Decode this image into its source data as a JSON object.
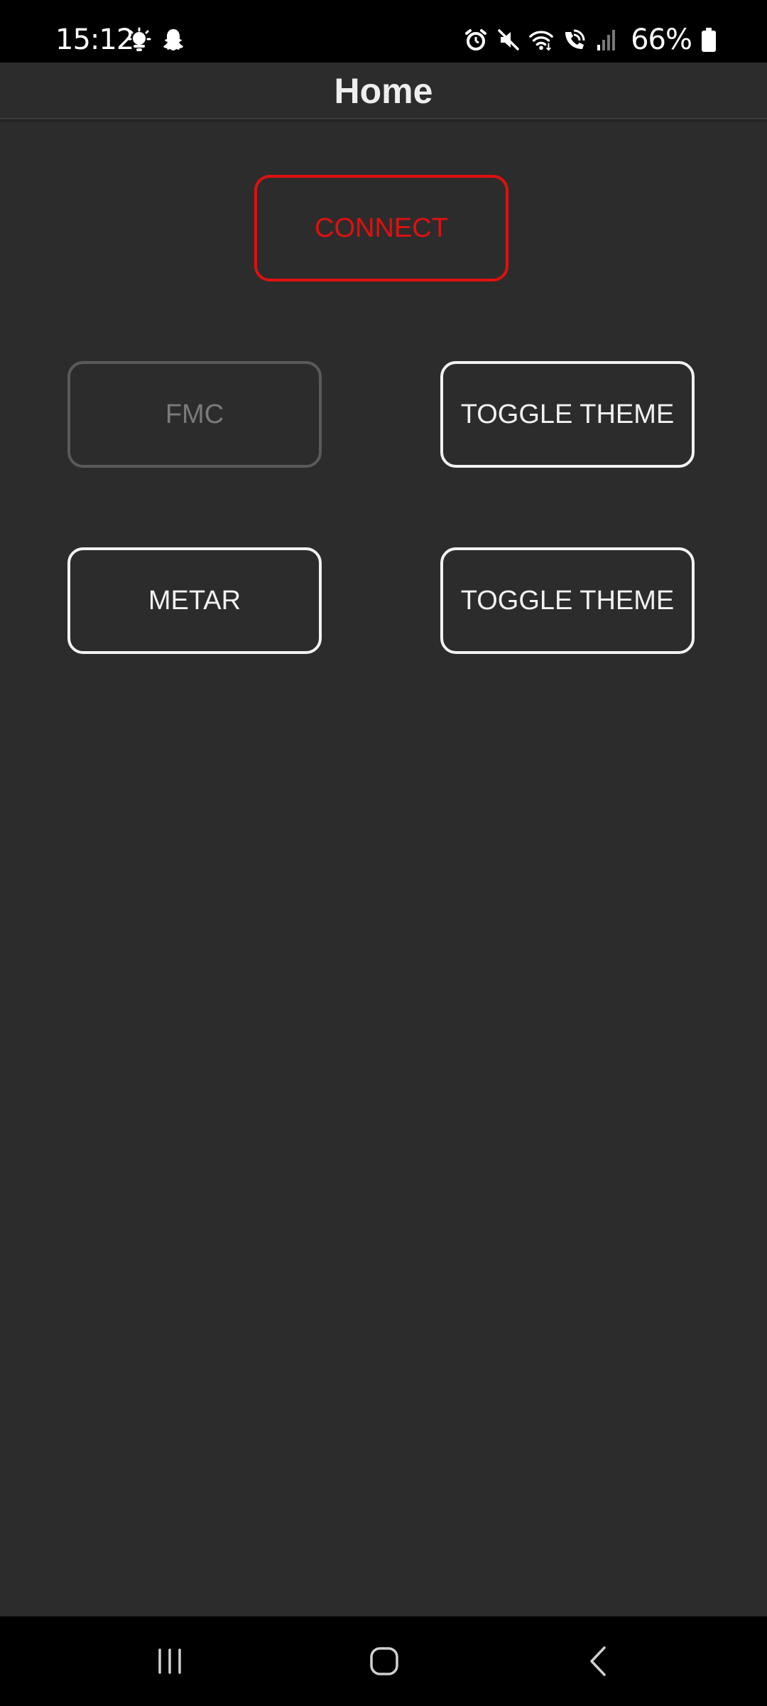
{
  "status_bar": {
    "time": "15:12",
    "left_icons": [
      "weather-icon",
      "snapchat-icon"
    ],
    "right_icons": [
      "alarm-icon",
      "mute-icon",
      "wifi-icon",
      "wifi-call-icon",
      "signal-icon"
    ],
    "battery": "66%"
  },
  "app_bar": {
    "title": "Home"
  },
  "buttons": {
    "connect": "CONNECT",
    "fmc": "FMC",
    "toggle_theme_1": "TOGGLE THEME",
    "metar": "METAR",
    "toggle_theme_2": "TOGGLE THEME"
  },
  "colors": {
    "background": "#2c2c2c",
    "connect_accent": "#e01010",
    "disabled": "#5a5a5a",
    "outline": "#f2f2f2"
  },
  "nav_bar": {
    "icons": [
      "recents-icon",
      "home-icon",
      "back-icon"
    ]
  }
}
